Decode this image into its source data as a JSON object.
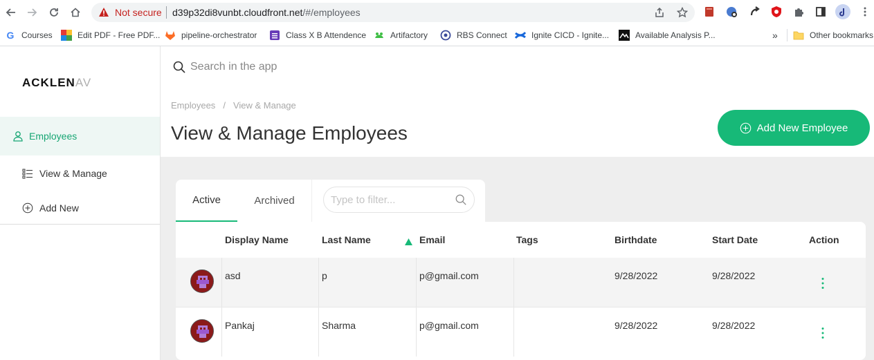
{
  "browser": {
    "not_secure": "Not secure",
    "url_host": "d39p32di8vunbt.cloudfront.net",
    "url_path": "/#/employees",
    "bookmarks": [
      {
        "label": "Courses",
        "icon": "google-icon"
      },
      {
        "label": "Edit PDF - Free PDF...",
        "icon": "pdf-icon"
      },
      {
        "label": "pipeline-orchestrator",
        "icon": "gitlab-icon"
      },
      {
        "label": "Class X B Attendence",
        "icon": "forms-icon"
      },
      {
        "label": "Artifactory",
        "icon": "frog-icon"
      },
      {
        "label": "RBS Connect",
        "icon": "connect-icon"
      },
      {
        "label": "Ignite CICD - Ignite...",
        "icon": "confluence-icon"
      },
      {
        "label": "Available Analysis P...",
        "icon": "analysis-icon"
      }
    ],
    "more": "»",
    "other_bookmarks": "Other bookmarks"
  },
  "app": {
    "logo_main": "ACKLEN",
    "logo_fade": "AV",
    "nav": {
      "section": "Employees",
      "items": [
        "View & Manage",
        "Add New"
      ]
    },
    "search_placeholder": "Search in the app",
    "breadcrumb": [
      "Employees",
      "View & Manage"
    ],
    "breadcrumb_sep": "/",
    "title": "View & Manage Employees",
    "add_button": "Add New Employee",
    "tabs": [
      "Active",
      "Archived"
    ],
    "filter_placeholder": "Type to filter...",
    "columns": [
      "Display Name",
      "Last Name",
      "Email",
      "Tags",
      "Birthdate",
      "Start Date",
      "Action"
    ],
    "rows": [
      {
        "display_name": "asd",
        "last_name": "p",
        "email": "p@gmail.com",
        "tags": "",
        "birthdate": "9/28/2022",
        "start_date": "9/28/2022"
      },
      {
        "display_name": "Pankaj",
        "last_name": "Sharma",
        "email": "p@gmail.com",
        "tags": "",
        "birthdate": "9/28/2022",
        "start_date": "9/28/2022"
      }
    ],
    "accent": "#17b978"
  }
}
